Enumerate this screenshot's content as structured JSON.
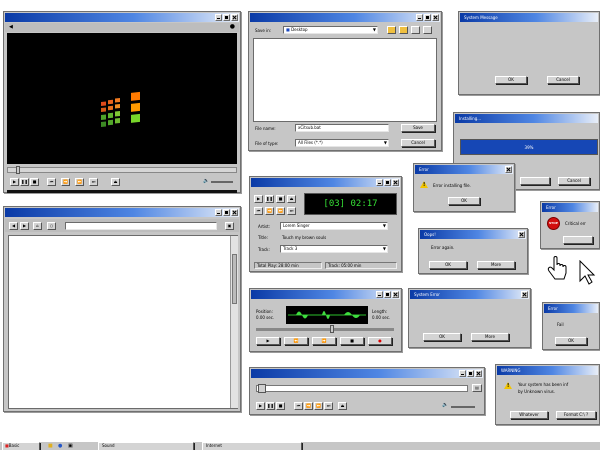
{
  "media_player": {
    "title": "",
    "play": "▶",
    "pause": "❚❚",
    "stop": "■",
    "prev": "⏮",
    "rew": "⏪",
    "fwd": "⏩",
    "next": "⏭",
    "eject": "⏏",
    "vol": "🔈",
    "vol_max": "🔊"
  },
  "save_dialog": {
    "save_in_label": "Save in:",
    "save_in_value": "Desktop",
    "file_name_label": "File name:",
    "file_name_value": "xCitsub.bat",
    "file_type_label": "File of type:",
    "file_type_value": "All Files (*.*)",
    "save_btn": "Save",
    "cancel_btn": "Cancel"
  },
  "system_message": {
    "title": "System Message",
    "ok_btn": "OK",
    "cancel_btn": "Cancel"
  },
  "installing": {
    "title": "Installing...",
    "progress_text": "39%",
    "progress": 0.39,
    "cancel_btn": "Cancel"
  },
  "browser": {
    "title": ""
  },
  "cd_player": {
    "title": "",
    "display": "[03] 02:17",
    "artist_label": "Artist:",
    "artist_value": "Lorem Singer",
    "title_label": "Title:",
    "title_value": "Touch my brown souls",
    "track_label": "Track:",
    "track_value": "Track 3",
    "total_play": "Total Play: 28:00 min",
    "track_time": "Track: 05:00 min"
  },
  "error_install": {
    "title": "Error",
    "message": "Error installing file.",
    "ok_btn": "OK"
  },
  "oops": {
    "title": "Oops!",
    "message": "Error again.",
    "ok_btn": "OK",
    "more_btn": "More"
  },
  "error_critical": {
    "title": "Error",
    "message": "Critical err",
    "icon_text": "STOP"
  },
  "recorder": {
    "title": "",
    "position_label": "Position:",
    "position_value": "0.00 sec.",
    "length_label": "Length:",
    "length_value": "0.00 sec."
  },
  "system_error": {
    "title": "System Error",
    "ok_btn": "OK",
    "more_btn": "More"
  },
  "error_fail": {
    "title": "Error",
    "message": "Fail",
    "ok_btn": "OK"
  },
  "warning": {
    "title": "WARNING",
    "message_line1": "Your system has been inf",
    "message_line2": "by Unknown virus.",
    "whatever_btn": "Whatever",
    "format_btn": "Format C:\\ ?"
  },
  "taskbar": {
    "start_label": "Basic",
    "task1": "Sound",
    "task2": "Internet"
  }
}
